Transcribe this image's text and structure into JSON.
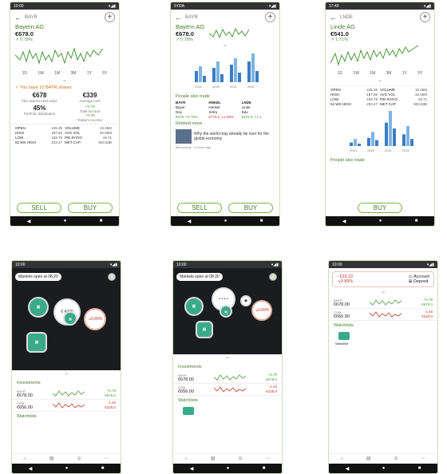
{
  "status": {
    "t1": "10:00",
    "t2": "9:00A",
    "t3": "17:40"
  },
  "p1": {
    "symbol": "BAYR",
    "name": "Bayern AG",
    "price": "€678.0",
    "change": "↗ 0.78%",
    "ranges": [
      "1D",
      "1W",
      "1M",
      "3M",
      "1Y",
      "5Y"
    ],
    "notice": "✓ You have 10 BAYR shares",
    "tiles": [
      {
        "v": "€678",
        "l": "The asset's total value"
      },
      {
        "v": "€339",
        "l": "Average cost"
      },
      {
        "v": "45%",
        "l": "Portfolio distribution"
      },
      {
        "l1": "↗0.78",
        "l2": "Total income",
        "l3": "↗0.39",
        "l4": "Today's income"
      }
    ],
    "stats": [
      [
        "OPEN",
        "245.35",
        "VOLUME",
        "15.45M"
      ],
      [
        "HIGH",
        "187.66",
        "AVG VOL",
        "32.65M"
      ],
      [
        "LOW",
        "183.79",
        "P/E RATIO",
        "19.71"
      ],
      [
        "52 WK HIGH",
        "233.47",
        "MKT CAP",
        "903.63B"
      ]
    ],
    "sell": "SELL",
    "buy": "BUY"
  },
  "p2": {
    "symbol": "BAYR",
    "name": "Bayern AG",
    "price": "€678.0",
    "change": "↗ 0.78%",
    "peers_title": "People also trade",
    "peers": [
      [
        "BAYR",
        "HNKEL",
        "LNDE"
      ],
      [
        "Bayer",
        "Henkel",
        "Linde"
      ],
      [
        "Dax",
        "Xetra",
        "Dax"
      ],
      [
        "€678 ↗0.78%",
        "€773.2 ↘1.99%",
        "€541.0 ↗1.1"
      ]
    ],
    "news_title": "Related news",
    "news": "Why the world may already be over for the global economy",
    "source": "Bloomberg · 3 hours ago",
    "sell": "SELL",
    "buy": "BUY",
    "bars": [
      [
        14,
        20,
        8
      ],
      [
        18,
        26,
        10
      ],
      [
        22,
        30,
        12
      ],
      [
        26,
        36,
        14
      ]
    ],
    "years": [
      "2019",
      "2020",
      "2021",
      "2022"
    ]
  },
  "p3": {
    "symbol": "LNDE",
    "name": "Linde AG",
    "price": "€541.0",
    "change": "↗ 1.71%",
    "ranges": [
      "1D",
      "1W",
      "1M",
      "3M",
      "1Y",
      "5Y"
    ],
    "stats": [
      [
        "OPEN",
        "245.35",
        "VOLUME",
        "15.45M"
      ],
      [
        "HIGH",
        "187.66",
        "AVG VOL",
        "32.65M"
      ],
      [
        "LOW",
        "183.79",
        "P/E RATIO",
        "19.71"
      ],
      [
        "52 WK HIGH",
        "233.47",
        "MKT CAP",
        "903.63B"
      ]
    ],
    "peers_title": "People also trade",
    "buy": "BUY",
    "bars": [
      [
        6,
        12,
        4
      ],
      [
        14,
        24,
        10
      ],
      [
        40,
        60,
        30
      ],
      [
        20,
        34,
        12
      ]
    ],
    "years": [
      "2019",
      "2020",
      "2021",
      "2022"
    ]
  },
  "p4": {
    "banner": "Markets open at 08:20",
    "b_val": "€ 4200",
    "b_chg": "↘0.89%",
    "inv": "Investments",
    "watch": "Watchlists",
    "rows": [
      {
        "sym": "BAYR",
        "val": "€678.00",
        "chg": "+0.78",
        "sub": "€678.0",
        "dir": "up"
      },
      {
        "sym": "COM",
        "val": "€656.00",
        "chg": "-1.45",
        "sub": "€328.0",
        "dir": "dn"
      }
    ]
  },
  "p5": {
    "banner": "Markets open at 08:20",
    "b_val": "• • • •",
    "b_chg": "↘0.89%",
    "inv": "Investments",
    "watch": "Watchlists",
    "rows": [
      {
        "sym": "BAYR",
        "val": "€678.00",
        "chg": "+0.78",
        "sub": "€678.0",
        "dir": "up"
      },
      {
        "sym": "COM",
        "val": "€656.00",
        "chg": "-1.45",
        "sub": "€328.0",
        "dir": "dn"
      }
    ]
  },
  "p6": {
    "loss": "- €29.22",
    "pct": "↘0.89%",
    "acct": "Account",
    "dep": "Deposit",
    "watch": "Watchlists",
    "wlabel": "Watchlist",
    "rows": [
      {
        "sym": "BAYR",
        "val": "€678.00",
        "chg": "+0.78",
        "sub": "€678.0",
        "dir": "up"
      },
      {
        "sym": "COM",
        "val": "€656.00",
        "chg": "-1.45",
        "sub": "€328.0",
        "dir": "dn"
      }
    ]
  },
  "nav": {
    "back": "◀",
    "home": "●",
    "recent": "■"
  },
  "colors": {
    "accent": "#4a7a2a",
    "up": "#4a9a3a",
    "down": "#c0392b",
    "bar1": "#3b7dc4",
    "bar2": "#7db4e3"
  }
}
